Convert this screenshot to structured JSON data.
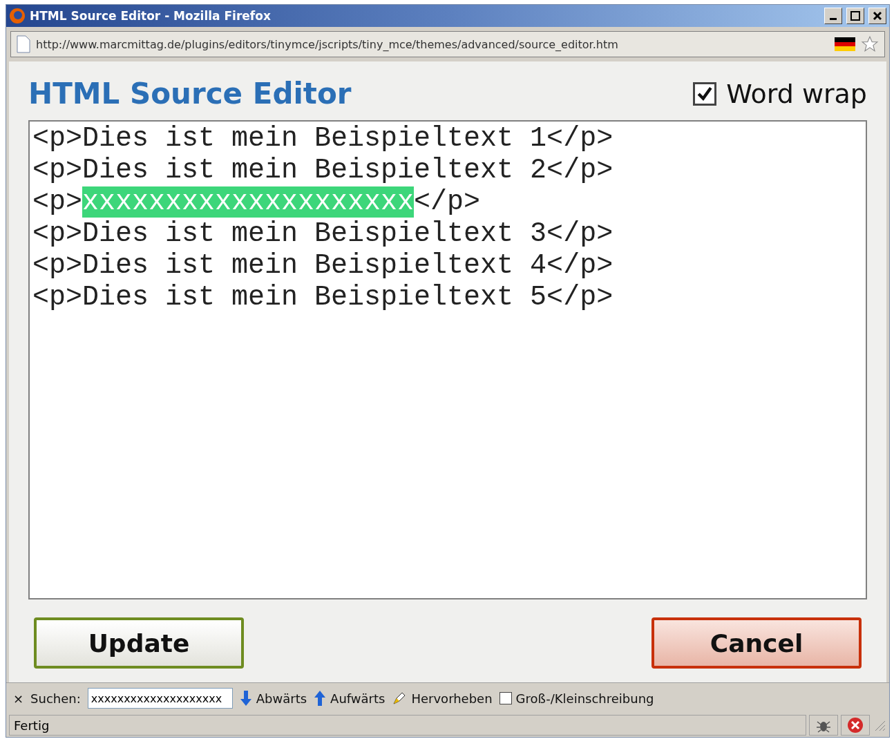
{
  "window": {
    "title": "HTML Source Editor - Mozilla Firefox"
  },
  "address_bar": {
    "url": "http://www.marcmittag.de/plugins/editors/tinymce/jscripts/tiny_mce/themes/advanced/source_editor.htm"
  },
  "heading": "HTML Source Editor",
  "word_wrap": {
    "label": "Word wrap",
    "checked": true
  },
  "editor": {
    "lines": [
      {
        "segments": [
          {
            "text": "<p>Dies ist mein Beispieltext 1</p>",
            "highlighted": false
          }
        ]
      },
      {
        "segments": [
          {
            "text": "<p>Dies ist mein Beispieltext 2</p>",
            "highlighted": false
          }
        ]
      },
      {
        "segments": [
          {
            "text": "<p>",
            "highlighted": false
          },
          {
            "text": "xxxxxxxxxxxxxxxxxxxx",
            "highlighted": true
          },
          {
            "text": "</p>",
            "highlighted": false
          }
        ]
      },
      {
        "segments": [
          {
            "text": "<p>Dies ist mein Beispieltext 3</p>",
            "highlighted": false
          }
        ]
      },
      {
        "segments": [
          {
            "text": "<p>Dies ist mein Beispieltext 4</p>",
            "highlighted": false
          }
        ]
      },
      {
        "segments": [
          {
            "text": "<p>Dies ist mein Beispieltext 5</p>",
            "highlighted": false
          }
        ]
      }
    ]
  },
  "buttons": [
    {
      "label": "Update",
      "kind": "confirm"
    },
    {
      "label": "Cancel",
      "kind": "cancel"
    }
  ],
  "find_bar": {
    "close": "×",
    "label": "Suchen:",
    "value": "xxxxxxxxxxxxxxxxxxxx",
    "next": "Abwärts",
    "previous": "Aufwärts",
    "highlight": "Hervorheben",
    "match_case": {
      "label": "Groß-/Kleinschreibung",
      "checked": false
    }
  },
  "status_bar": {
    "text": "Fertig"
  }
}
